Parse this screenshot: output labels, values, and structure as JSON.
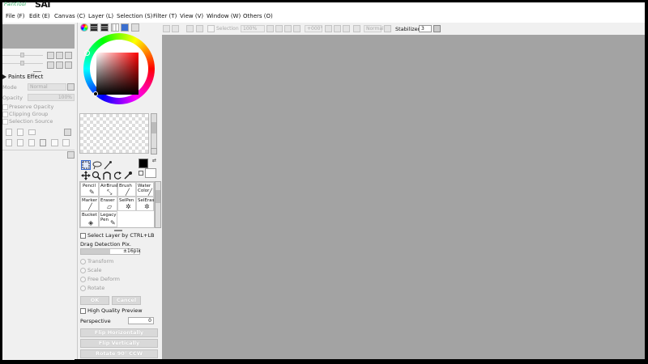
{
  "app": {
    "logo_small": "PaintTool",
    "logo_big": "SAI"
  },
  "menu": [
    {
      "label": "File (F)"
    },
    {
      "label": "Edit (E)"
    },
    {
      "label": "Canvas (C)"
    },
    {
      "label": "Layer (L)"
    },
    {
      "label": "Selection (S)"
    },
    {
      "label": "Filter (T)"
    },
    {
      "label": "View (V)"
    },
    {
      "label": "Window (W)"
    },
    {
      "label": "Others (O)"
    }
  ],
  "toolbar": {
    "selection_label": "Selection",
    "zoom_value": "100%",
    "angle_value": "+000°",
    "blend_mode": "Normal",
    "stabilizer_label": "Stabilizer",
    "stabilizer_value": "3"
  },
  "layer_panel": {
    "paints_effect_label": "Paints Effect",
    "mode_label": "Mode",
    "mode_value": "Normal",
    "opacity_label": "Opacity",
    "opacity_value": "100%",
    "preserve_opacity": "Preserve Opacity",
    "clipping_group": "Clipping Group",
    "selection_source": "Selection Source"
  },
  "color": {
    "primary": "#000000",
    "secondary": "#ffffff",
    "hue": "#ff0000"
  },
  "brushes": [
    {
      "name": "Pencil",
      "icon": "pencil-icon"
    },
    {
      "name": "AirBrush",
      "icon": "airbrush-icon"
    },
    {
      "name": "Brush",
      "icon": "brush-icon"
    },
    {
      "name": "Water Color",
      "icon": "watercolor-icon"
    },
    {
      "name": "Marker",
      "icon": "marker-icon"
    },
    {
      "name": "Eraser",
      "icon": "eraser-icon"
    },
    {
      "name": "SelPen",
      "icon": "selpen-icon"
    },
    {
      "name": "SelEras",
      "icon": "seleras-icon"
    },
    {
      "name": "Bucket",
      "icon": "bucket-icon"
    },
    {
      "name": "Legacy Pen",
      "icon": "legacy-pen-icon"
    }
  ],
  "tool_options": {
    "select_layer_ctrl_lb": "Select Layer by CTRL+LB",
    "drag_detection_label": "Drag Detection Pix.",
    "drag_detection_value": "±16pix",
    "transform": "Transform",
    "scale": "Scale",
    "free_deform": "Free Deform",
    "rotate": "Rotate",
    "ok": "OK",
    "cancel": "Cancel",
    "high_quality_preview": "High Quality Preview",
    "perspective_label": "Perspective",
    "perspective_value": "0",
    "flip_horizontally": "Flip Horizontally",
    "flip_vertically": "Flip Vertically",
    "rotate_ccw": "Rotate 90° CCW"
  }
}
